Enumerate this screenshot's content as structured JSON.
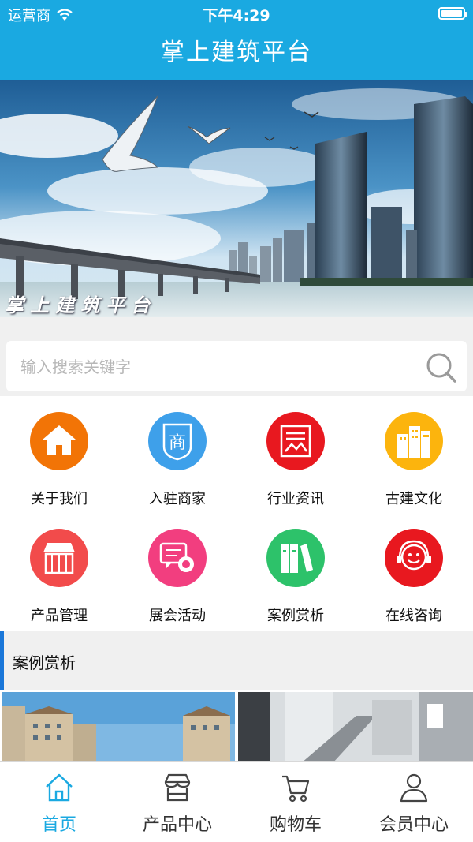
{
  "status_bar": {
    "carrier": "运营商",
    "time": "下午4:29"
  },
  "navbar": {
    "title": "掌上建筑平台"
  },
  "banner": {
    "caption": "掌上建筑平台"
  },
  "search": {
    "placeholder": "输入搜索关键字"
  },
  "menu": {
    "items": [
      {
        "label": "关于我们",
        "icon": "home-icon",
        "color": "#f27406"
      },
      {
        "label": "入驻商家",
        "icon": "merchant-badge-icon",
        "color": "#3ea0ea"
      },
      {
        "label": "行业资讯",
        "icon": "news-icon",
        "color": "#e8181f"
      },
      {
        "label": "古建文化",
        "icon": "building-icon",
        "color": "#fcb40d"
      },
      {
        "label": "产品管理",
        "icon": "storefront-icon",
        "color": "#f24b4b"
      },
      {
        "label": "展会活动",
        "icon": "exhibition-chat-icon",
        "color": "#f23e7f"
      },
      {
        "label": "案例赏析",
        "icon": "books-icon",
        "color": "#2dc26a"
      },
      {
        "label": "在线咨询",
        "icon": "support-agent-icon",
        "color": "#e8181f"
      }
    ]
  },
  "section": {
    "title": "案例赏析"
  },
  "tabbar": {
    "tabs": [
      {
        "label": "首页",
        "icon": "home-outline-icon",
        "active": true
      },
      {
        "label": "产品中心",
        "icon": "shop-icon",
        "active": false
      },
      {
        "label": "购物车",
        "icon": "cart-icon",
        "active": false
      },
      {
        "label": "会员中心",
        "icon": "user-icon",
        "active": false
      }
    ]
  },
  "colors": {
    "accent": "#1aa9e1",
    "section_bar": "#1a77d9"
  }
}
